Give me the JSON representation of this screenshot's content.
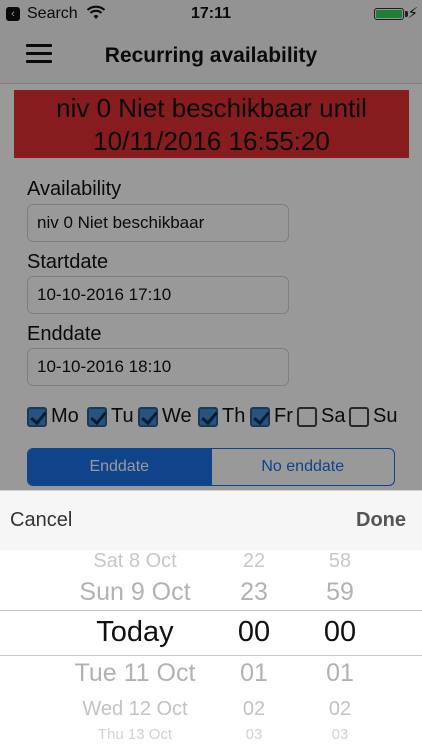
{
  "status_bar": {
    "back_glyph": "‹",
    "back_label": "Search",
    "time": "17:11",
    "charging_glyph": "⚡"
  },
  "nav": {
    "title": "Recurring availability"
  },
  "banner": {
    "line1": "niv 0 Niet beschikbaar until",
    "line2": "10/11/2016 16:55:20",
    "color": "#e12f33"
  },
  "form": {
    "availability_label": "Availability",
    "availability_value": "niv 0 Niet beschikbaar",
    "startdate_label": "Startdate",
    "startdate_value": "10-10-2016 17:10",
    "enddate_label": "Enddate",
    "enddate_value": "10-10-2016 18:10"
  },
  "days": [
    {
      "label": "Mo",
      "checked": true
    },
    {
      "label": "Tu",
      "checked": true
    },
    {
      "label": "We",
      "checked": true
    },
    {
      "label": "Th",
      "checked": true
    },
    {
      "label": "Fr",
      "checked": true
    },
    {
      "label": "Sa",
      "checked": false
    },
    {
      "label": "Su",
      "checked": false
    }
  ],
  "segmented": {
    "options": [
      "Enddate",
      "No enddate"
    ],
    "selected": "Enddate",
    "accent": "#1a72e8"
  },
  "picker_toolbar": {
    "cancel": "Cancel",
    "done": "Done"
  },
  "picker": {
    "dates": [
      "Sat 8 Oct",
      "Sun 9 Oct",
      "Today",
      "Tue 11 Oct",
      "Wed 12 Oct",
      "Thu 13 Oct"
    ],
    "hours": [
      "22",
      "23",
      "00",
      "01",
      "02",
      "03"
    ],
    "minutes": [
      "58",
      "59",
      "00",
      "01",
      "02",
      "03"
    ],
    "selected_date": "Today",
    "selected_hour": "00",
    "selected_minute": "00"
  }
}
